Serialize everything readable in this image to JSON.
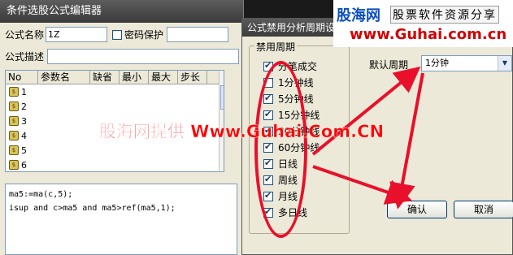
{
  "editor": {
    "title": "条件选股公式编辑器",
    "name_label": "公式名称",
    "name_value": "1Z",
    "password_label": "密码保护",
    "desc_label": "公式描述",
    "param_headers": [
      "No",
      "参数名",
      "缺省",
      "最小",
      "最大",
      "步长"
    ],
    "param_rows": [
      "1",
      "2",
      "3",
      "4",
      "5",
      "6"
    ],
    "code_lines": [
      "ma5:=ma(c,5);",
      "isup and c>ma5 and ma5>ref(ma5,1);"
    ]
  },
  "dialog": {
    "title": "公式禁用分析周期设",
    "group_title": "禁用周期",
    "periods": [
      {
        "label": "分笔成交",
        "checked": true
      },
      {
        "label": "1分钟线",
        "checked": false
      },
      {
        "label": "5分钟线",
        "checked": true
      },
      {
        "label": "15分钟线",
        "checked": true
      },
      {
        "label": "30分钟线",
        "checked": true
      },
      {
        "label": "60分钟线",
        "checked": true
      },
      {
        "label": "日线",
        "checked": true
      },
      {
        "label": "周线",
        "checked": true
      },
      {
        "label": "月线",
        "checked": true
      },
      {
        "label": "多日线",
        "checked": true
      }
    ],
    "default_label": "默认周期",
    "default_value": "1分钟",
    "ok_label": "确认",
    "cancel_label": "取消"
  },
  "watermark": "股海网提供 Www.Guhai.Com.CN",
  "logo": {
    "name": "股海网",
    "slogan": "股票软件资源分享",
    "url": "www.Guhai.com.cn"
  },
  "colors": {
    "annotation_red": "#e8102a",
    "watermark_red": "#ff0000",
    "logo_blue": "#0a4fc1"
  }
}
